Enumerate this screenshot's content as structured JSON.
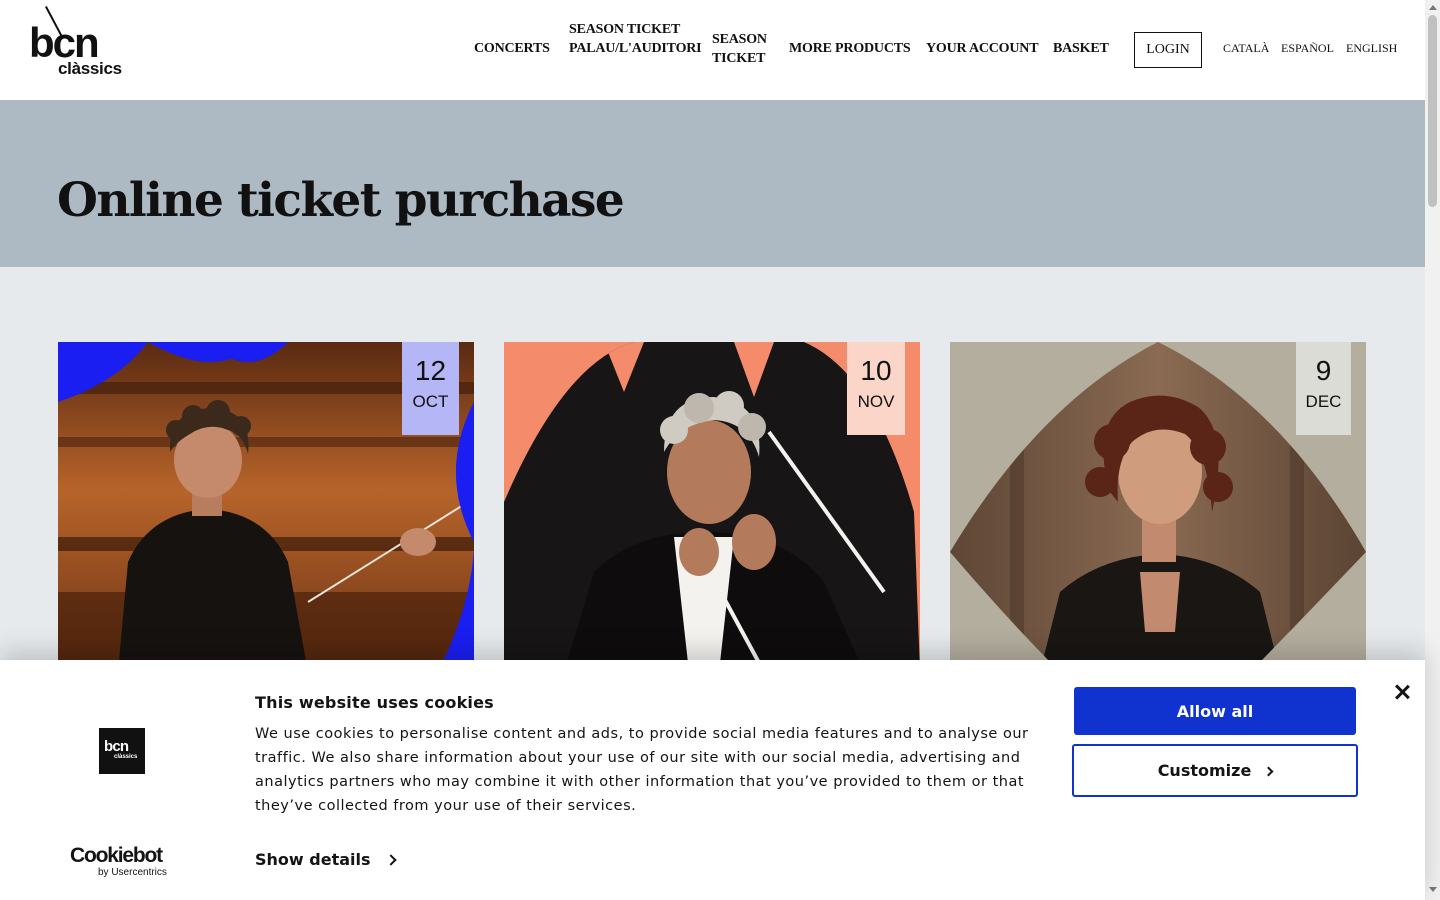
{
  "header": {
    "logo_top": "bcn",
    "logo_bottom": "clàssics",
    "nav": {
      "concerts": "CONCERTS",
      "season_ticket_palau": "SEASON TICKET PALAU/L'AUDITORI",
      "season_ticket": "SEASON TICKET",
      "more_products": "MORE PRODUCTS",
      "your_account": "YOUR ACCOUNT",
      "basket": "BASKET"
    },
    "login": "LOGIN",
    "languages": {
      "ca": "CATALÀ",
      "es": "ESPAÑOL",
      "en": "ENGLISH"
    }
  },
  "hero": {
    "title": "Online ticket purchase"
  },
  "cards": [
    {
      "day": "12",
      "month": "OCT",
      "accent": "#1a1ef0"
    },
    {
      "day": "10",
      "month": "NOV",
      "accent": "#f48c6c"
    },
    {
      "day": "9",
      "month": "DEC",
      "accent": "#b3ae9e"
    }
  ],
  "cookie_banner": {
    "logo_top": "bcn",
    "logo_bottom": "clàssics",
    "title": "This website uses cookies",
    "body": "We use cookies to personalise content and ads, to provide social media features and to analyse our traffic. We also share information about your use of our site with our social media, advertising and analytics partners who may combine it with other information that you’ve provided to them or that they’ve collected from your use of their services.",
    "show_details": "Show details",
    "allow_all": "Allow all",
    "customize": "Customize",
    "brand_name": "Cookiebot",
    "brand_by": "by Usercentrics",
    "accent_color": "#1032cf"
  }
}
